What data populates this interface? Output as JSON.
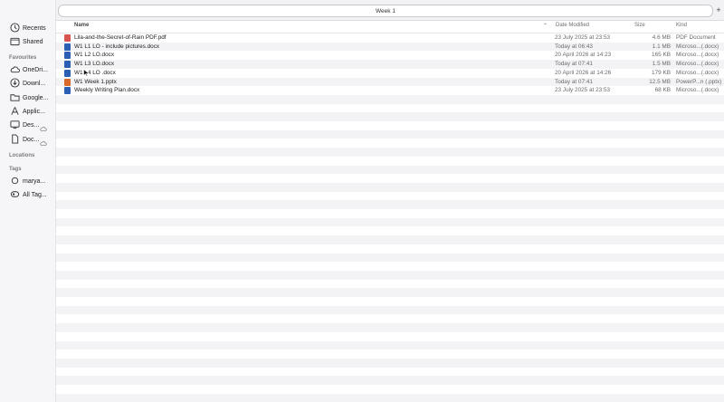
{
  "sidebar": {
    "top_items": [
      {
        "label": "Recents",
        "icon": "clock-icon"
      },
      {
        "label": "Shared",
        "icon": "shared-folder-icon"
      }
    ],
    "favourites_heading": "Favourites",
    "favourites": [
      {
        "label": "OneDri...",
        "icon": "cloud-icon",
        "cloud": false
      },
      {
        "label": "Downl...",
        "icon": "download-icon",
        "cloud": false
      },
      {
        "label": "Google...",
        "icon": "folder-icon",
        "cloud": false
      },
      {
        "label": "Applic...",
        "icon": "applications-icon",
        "cloud": false
      },
      {
        "label": "Des...",
        "icon": "desktop-icon",
        "cloud": true
      },
      {
        "label": "Doc...",
        "icon": "document-icon",
        "cloud": true
      }
    ],
    "locations_heading": "Locations",
    "tags_heading": "Tags",
    "tags": [
      {
        "label": "marya...",
        "icon": "tag-circle-icon"
      },
      {
        "label": "All Tag...",
        "icon": "all-tags-icon"
      }
    ]
  },
  "tabbar": {
    "tab_label": "Week 1",
    "add_label": "+"
  },
  "columns": {
    "name": "Name",
    "date": "Date Modified",
    "size": "Size",
    "kind": "Kind"
  },
  "files": [
    {
      "name": "Lila-and-the-Secret-of-Rain PDF.pdf",
      "date": "23 July 2025 at 23:53",
      "size": "4.6 MB",
      "kind": "PDF Document",
      "type": "pdf"
    },
    {
      "name": "W1 L1 LO - include pictures.docx",
      "date": "Today at 06:43",
      "size": "1.1 MB",
      "kind": "Microso...(.docx)",
      "type": "docx"
    },
    {
      "name": "W1 L2 LO.docx",
      "date": "20 April 2026 at 14:23",
      "size": "165 KB",
      "kind": "Microso...(.docx)",
      "type": "docx"
    },
    {
      "name": "W1 L3 LO.docx",
      "date": "Today at 07:41",
      "size": "1.5 MB",
      "kind": "Microso...(.docx)",
      "type": "docx"
    },
    {
      "name": "W1 L4 LO .docx",
      "date": "20 April 2026 at 14:26",
      "size": "179 KB",
      "kind": "Microso...(.docx)",
      "type": "docx"
    },
    {
      "name": "W1 Week 1.pptx",
      "date": "Today at 07:41",
      "size": "12.5 MB",
      "kind": "PowerP...n (.pptx)",
      "type": "pptx"
    },
    {
      "name": "Weekly Writing Plan.docx",
      "date": "23 July 2025 at 23:53",
      "size": "68 KB",
      "kind": "Microso...(.docx)",
      "type": "docx"
    }
  ],
  "colors": {
    "docx": "#2b5fb4",
    "pdf": "#d9534f",
    "pptx": "#d86a2d"
  }
}
